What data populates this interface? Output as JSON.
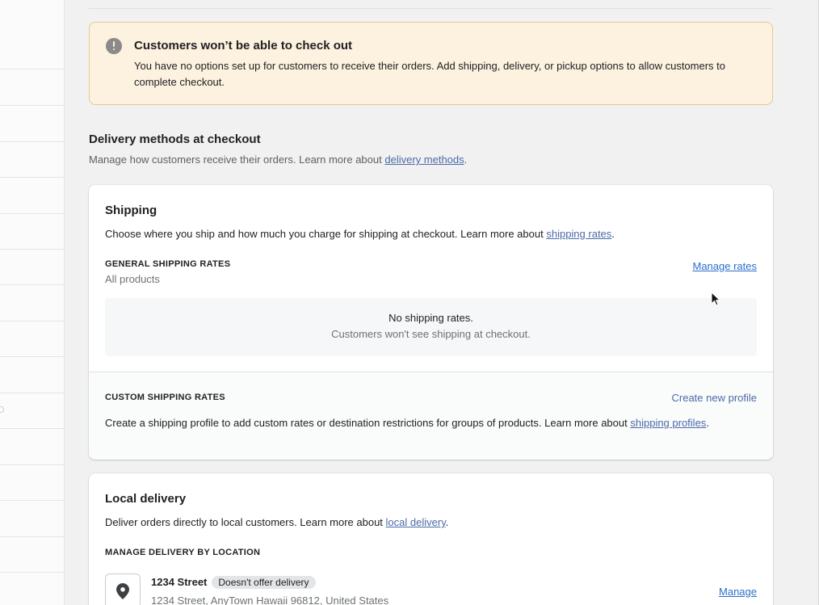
{
  "banner": {
    "title": "Customers won’t be able to check out",
    "body": "You have no options set up for customers to receive their orders. Add shipping, delivery, or pickup options to allow customers to complete checkout."
  },
  "delivery": {
    "title": "Delivery methods at checkout",
    "subtitle_prefix": "Manage how customers receive their orders. Learn more about ",
    "subtitle_link": "delivery methods",
    "subtitle_suffix": "."
  },
  "shipping": {
    "title": "Shipping",
    "desc_prefix": "Choose where you ship and how much you charge for shipping at checkout. Learn more about ",
    "desc_link": "shipping rates",
    "desc_suffix": ".",
    "general_label": "GENERAL SHIPPING RATES",
    "general_sub": "All products",
    "manage_rates": "Manage rates",
    "empty_line1": "No shipping rates.",
    "empty_line2": "Customers won't see shipping at checkout.",
    "custom_label": "CUSTOM SHIPPING RATES",
    "create_profile": "Create new profile",
    "custom_desc_prefix": "Create a shipping profile to add custom rates or destination restrictions for groups of products. Learn more about ",
    "custom_desc_link": "shipping profiles",
    "custom_desc_suffix": "."
  },
  "local": {
    "title": "Local delivery",
    "desc_prefix": "Deliver orders directly to local customers. Learn more about ",
    "desc_link": "local delivery",
    "desc_suffix": ".",
    "manage_label": "MANAGE DELIVERY BY LOCATION",
    "location_name": "1234 Street",
    "location_badge": "Doesn't offer delivery",
    "location_address": "1234 Street, AnyTown Hawaii 96812, United States",
    "manage": "Manage"
  },
  "icons": {
    "banner": "alert-circle-icon",
    "location": "location-pin-icon",
    "cursor": "mouse-pointer-icon"
  },
  "colors": {
    "banner_bg": "#fdf1df",
    "banner_border": "#e7c98d",
    "link": "#2c6ecb"
  }
}
